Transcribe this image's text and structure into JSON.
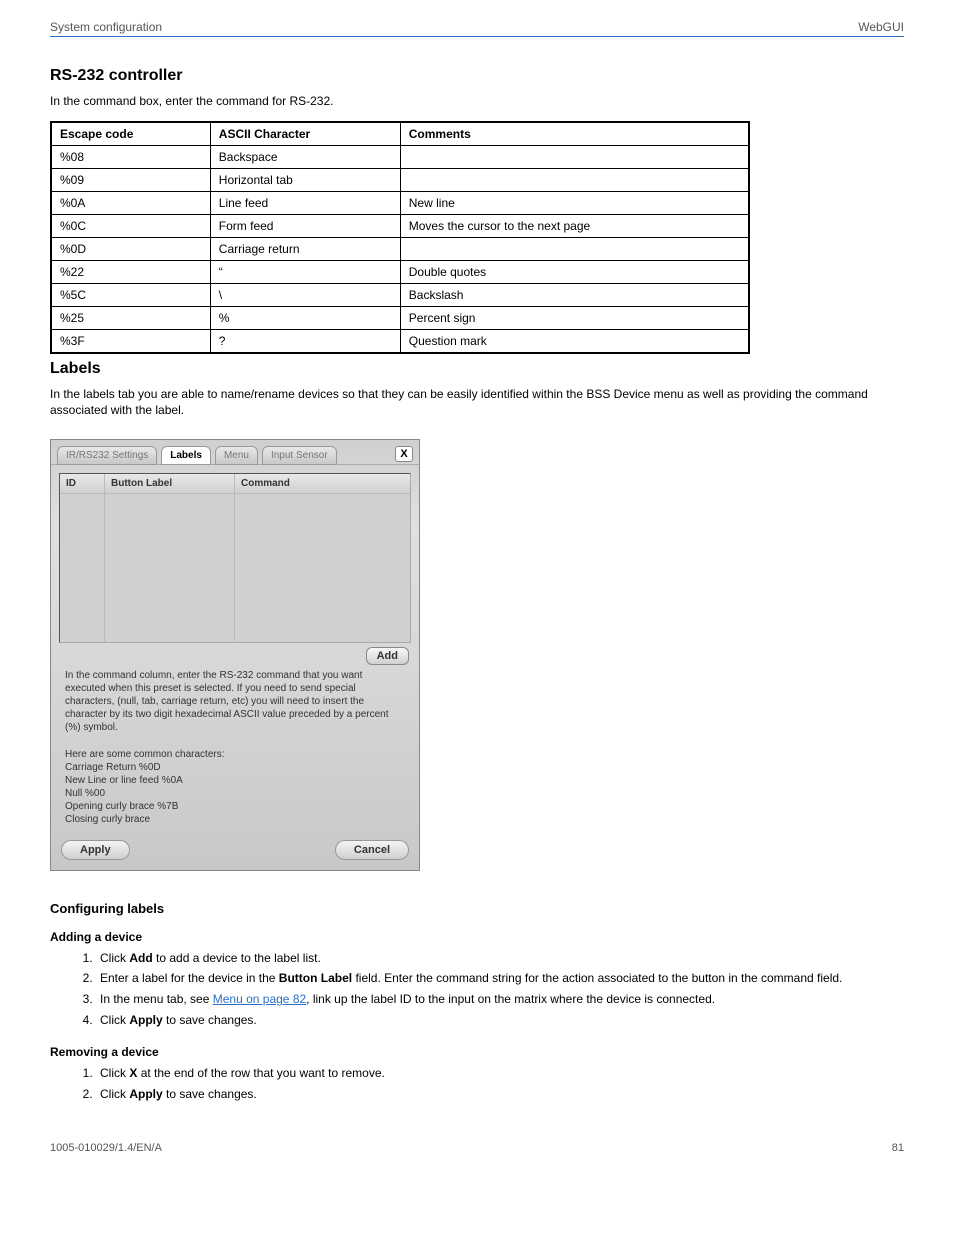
{
  "header": {
    "left": "System configuration",
    "right": "WebGUI"
  },
  "intro_title": "RS-232 controller",
  "intro_text": "In the command box, enter the command for RS-232.",
  "cmd_table": {
    "headers": [
      "Escape code",
      "ASCII Character",
      "Comments"
    ],
    "rows": [
      [
        "%08",
        "Backspace",
        ""
      ],
      [
        "%09",
        "Horizontal tab",
        ""
      ],
      [
        "%0A",
        "Line feed",
        "New line"
      ],
      [
        "%0C",
        "Form feed",
        "Moves the cursor to the next page"
      ],
      [
        "%0D",
        "Carriage return",
        ""
      ],
      [
        "%22",
        "“",
        "Double quotes"
      ],
      [
        "%5C",
        "\\",
        "Backslash"
      ],
      [
        "%25",
        "%",
        "Percent sign"
      ],
      [
        "%3F",
        "?",
        "Question mark"
      ]
    ]
  },
  "labels_section": {
    "title": "Labels",
    "text": "In the labels tab you are able to name/rename devices so that they can be easily identified within the BSS Device menu as well as providing the command associated with the label."
  },
  "dialog": {
    "tabs": [
      "IR/RS232 Settings",
      "Labels",
      "Menu",
      "Input Sensor"
    ],
    "active_tab": 1,
    "close": "X",
    "cols": {
      "id": "ID",
      "label": "Button Label",
      "cmd": "Command"
    },
    "add": "Add",
    "help_main": "In the command column, enter the RS-232 command that you want executed when this preset is selected. If you need to send special characters, (null, tab, carriage return, etc) you will need to insert the character by its two digit hexadecimal ASCII value preceded by a percent (%) symbol.",
    "help_common_intro": "Here are some common characters:",
    "help_lines": [
      "Carriage Return %0D",
      "New Line or line feed %0A",
      "Null %00",
      "Opening curly brace %7B",
      "Closing curly brace"
    ],
    "apply": "Apply",
    "cancel": "Cancel"
  },
  "config_title": "Configuring labels",
  "steps_add": {
    "title": "Adding a device",
    "items": [
      {
        "pre": "Click ",
        "b": "Add",
        "post": " to add a device to the label list."
      },
      {
        "pre": "Enter a label for the device in the ",
        "b": "Button Label",
        "post": " field. Enter the command string for the action associated to the button in the command field."
      },
      {
        "pre": "In the menu tab, see ",
        "link": "Menu on page 82",
        "post": ", link up the label ID to the input on the matrix where the device is connected."
      },
      {
        "pre": "Click ",
        "b": "Apply",
        "post": " to save changes."
      }
    ]
  },
  "steps_remove": {
    "title": "Removing a device",
    "items": [
      {
        "pre": "Click ",
        "b": "X",
        "post": " at the end of the row that you want to remove."
      },
      {
        "pre": "Click ",
        "b": "Apply",
        "post": " to save changes."
      }
    ]
  },
  "footer": {
    "left": "1005-010029/1.4/EN/A",
    "right": "81"
  }
}
